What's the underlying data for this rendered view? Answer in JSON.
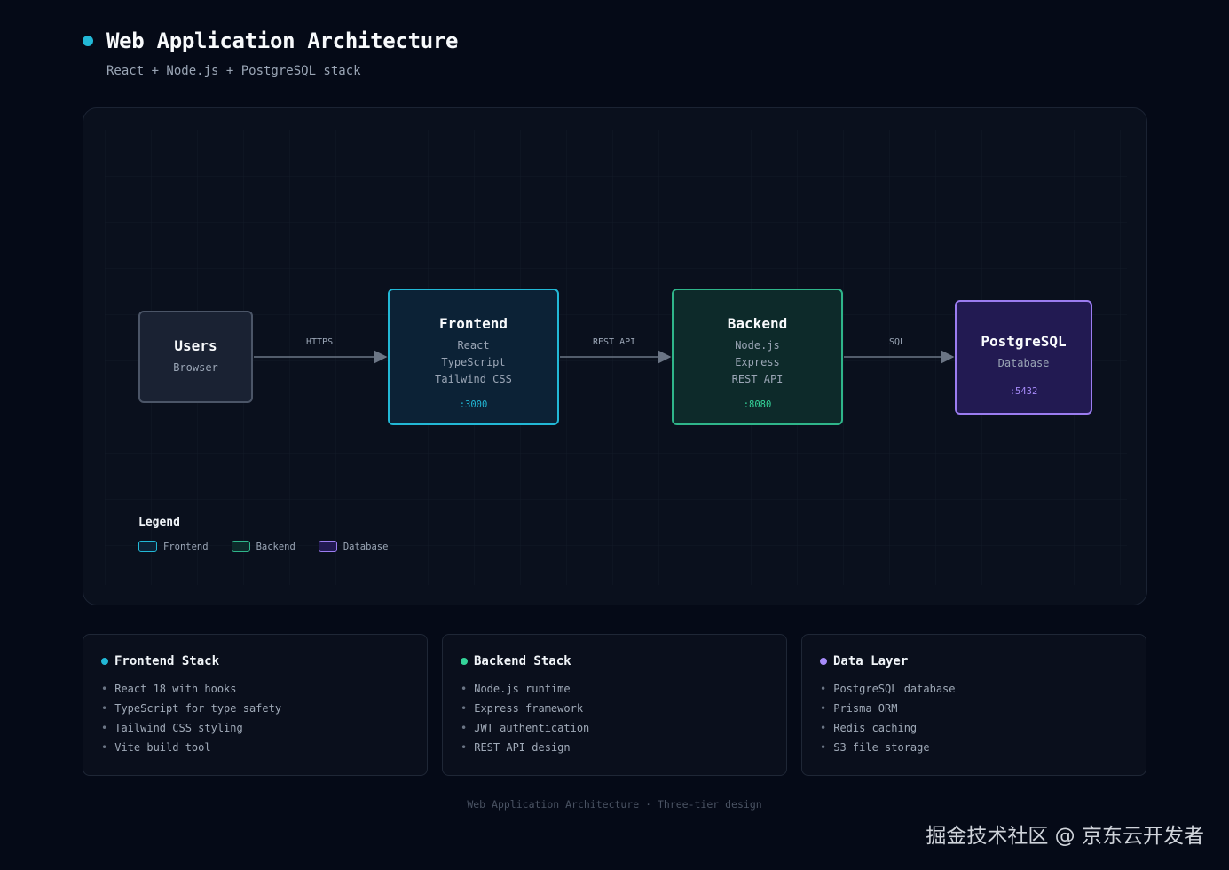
{
  "header": {
    "title": "Web Application Architecture",
    "subtitle": "React + Node.js + PostgreSQL stack",
    "accent": "#22b8d6"
  },
  "diagram": {
    "nodes": {
      "users": {
        "title": "Users",
        "lines": [
          "Browser"
        ]
      },
      "frontend": {
        "title": "Frontend",
        "lines": [
          "React",
          "TypeScript",
          "Tailwind CSS"
        ],
        "port": ":3000",
        "color": "#22b8d6"
      },
      "backend": {
        "title": "Backend",
        "lines": [
          "Node.js",
          "Express",
          "REST API"
        ],
        "port": ":8080",
        "color": "#2fb58a"
      },
      "database": {
        "title": "PostgreSQL",
        "lines": [
          "Database"
        ],
        "port": ":5432",
        "color": "#9b7cf0"
      }
    },
    "edges": [
      {
        "from": "users",
        "to": "frontend",
        "label": "HTTPS"
      },
      {
        "from": "frontend",
        "to": "backend",
        "label": "REST API"
      },
      {
        "from": "backend",
        "to": "database",
        "label": "SQL"
      }
    ],
    "legend": {
      "title": "Legend",
      "items": [
        {
          "label": "Frontend",
          "color": "#22b8d6"
        },
        {
          "label": "Backend",
          "color": "#2fb58a"
        },
        {
          "label": "Database",
          "color": "#9b7cf0"
        }
      ]
    }
  },
  "cards": [
    {
      "title": "Frontend Stack",
      "color": "#22b8d6",
      "items": [
        "React 18 with hooks",
        "TypeScript for type safety",
        "Tailwind CSS styling",
        "Vite build tool"
      ]
    },
    {
      "title": "Backend Stack",
      "color": "#34d399",
      "items": [
        "Node.js runtime",
        "Express framework",
        "JWT authentication",
        "REST API design"
      ]
    },
    {
      "title": "Data Layer",
      "color": "#a78bfa",
      "items": [
        "PostgreSQL database",
        "Prisma ORM",
        "Redis caching",
        "S3 file storage"
      ]
    }
  ],
  "footer": "Web Application Architecture · Three-tier design",
  "watermark": "掘金技术社区 @ 京东云开发者"
}
